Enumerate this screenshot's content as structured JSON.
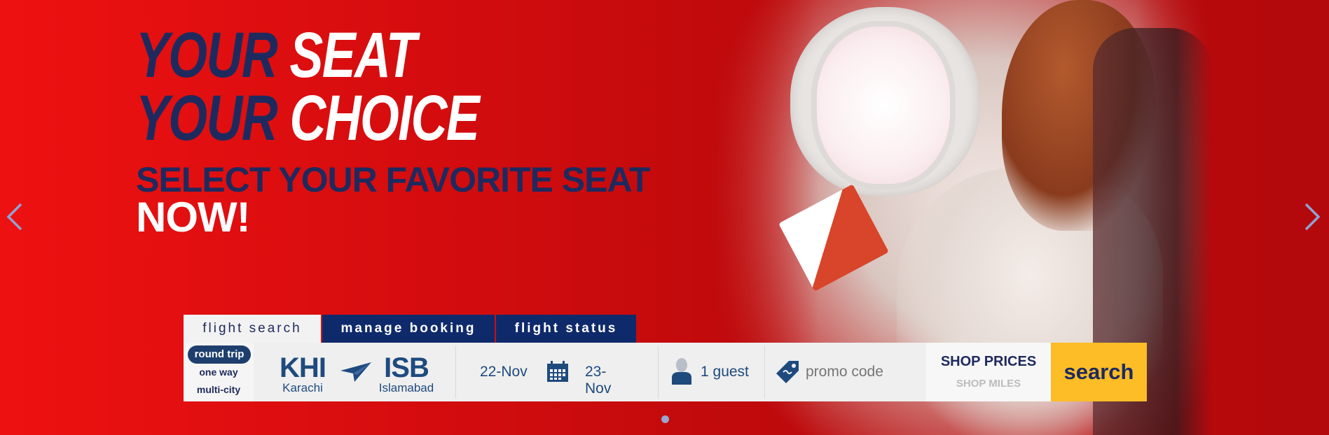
{
  "hero": {
    "headline_line1_dark": "YOUR",
    "headline_line1_light": "SEAT",
    "headline_line2_dark": "YOUR",
    "headline_line2_light": "CHOICE",
    "subline1": "SELECT YOUR FAVORITE SEAT",
    "subline2": "NOW!"
  },
  "tabs": [
    {
      "label": "flight search"
    },
    {
      "label": "manage booking"
    },
    {
      "label": "flight status"
    }
  ],
  "trip_type": {
    "options": [
      "round trip",
      "one way",
      "multi-city"
    ],
    "selected": "round trip"
  },
  "origin": {
    "code": "KHI",
    "city": "Karachi"
  },
  "destination": {
    "code": "ISB",
    "city": "Islamabad"
  },
  "dates": {
    "depart": "22-Nov",
    "return": "23-Nov"
  },
  "guests": {
    "label": "1 guest"
  },
  "promo": {
    "placeholder": "promo code"
  },
  "shop": {
    "prices": "SHOP PRICES",
    "miles": "SHOP MILES"
  },
  "search_button": "search",
  "carousel": {
    "slides_visible": 1,
    "active": 1
  },
  "colors": {
    "brand_red": "#d20c0e",
    "navy": "#1e2a5e",
    "accent_yellow": "#fcbd27",
    "tab_blue": "#0f2a6b"
  }
}
